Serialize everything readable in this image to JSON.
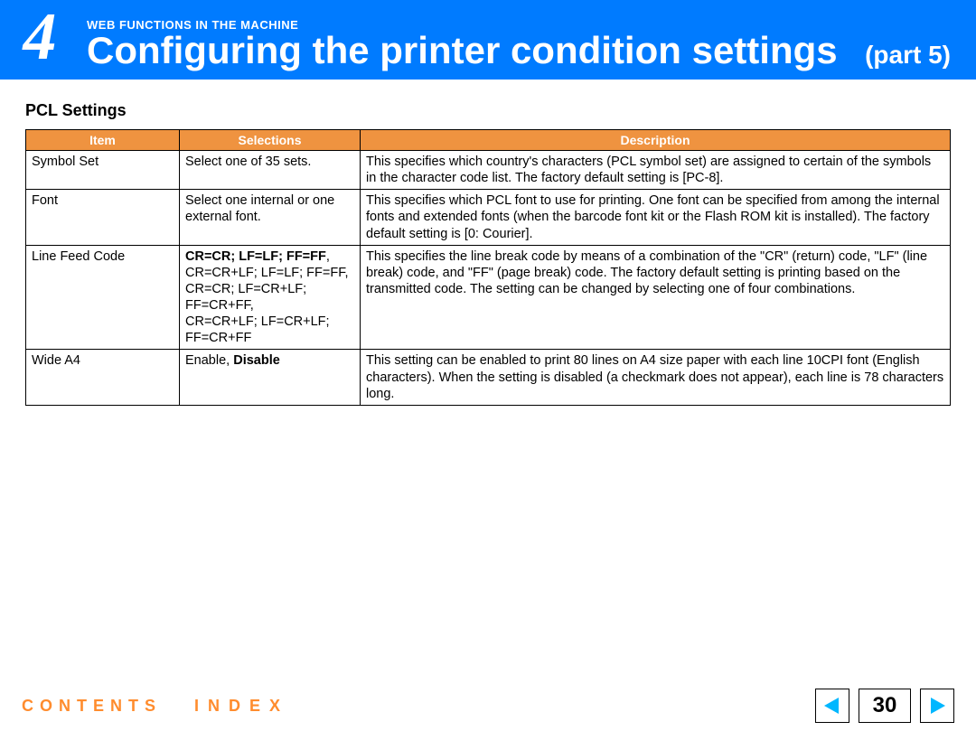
{
  "header": {
    "chapter_number": "4",
    "kicker": "WEB FUNCTIONS IN THE MACHINE",
    "title": "Configuring the printer condition settings",
    "part": "(part 5)"
  },
  "section_heading": "PCL Settings",
  "table": {
    "headers": {
      "item": "Item",
      "selections": "Selections",
      "description": "Description"
    },
    "rows": [
      {
        "item": "Symbol Set",
        "selections": "Select one of 35 sets.",
        "description": "This specifies which country's characters (PCL symbol set) are assigned to certain of the symbols in the character code list. The factory default setting is [PC-8]."
      },
      {
        "item": "Font",
        "selections": "Select one internal or one external font.",
        "description": "This specifies which PCL font to use for printing. One font can be specified from among the internal fonts and extended fonts (when the barcode font kit or the Flash ROM kit is installed). The factory default setting is [0: Courier]."
      },
      {
        "item": "Line Feed Code",
        "selections_rich": {
          "bold_lead": "CR=CR; LF=LF; FF=FF",
          "rest": ",\nCR=CR+LF; LF=LF; FF=FF,\nCR=CR; LF=CR+LF; FF=CR+FF,\nCR=CR+LF; LF=CR+LF; FF=CR+FF"
        },
        "description": "This specifies the line break code by means of a combination of the \"CR\" (return) code, \"LF\" (line break) code, and \"FF\" (page break) code. The factory default setting is printing based on the transmitted code. The setting can be changed by selecting one of four combinations."
      },
      {
        "item": "Wide A4",
        "selections_rich": {
          "lead": "Enable, ",
          "bold_tail": "Disable"
        },
        "description": "This setting can be enabled to print 80 lines on A4 size paper with each line 10CPI font (English characters). When the setting is disabled (a checkmark does not appear), each line is 78 characters long."
      }
    ]
  },
  "footer": {
    "contents": "CONTENTS",
    "index": "INDEX",
    "page_number": "30"
  }
}
